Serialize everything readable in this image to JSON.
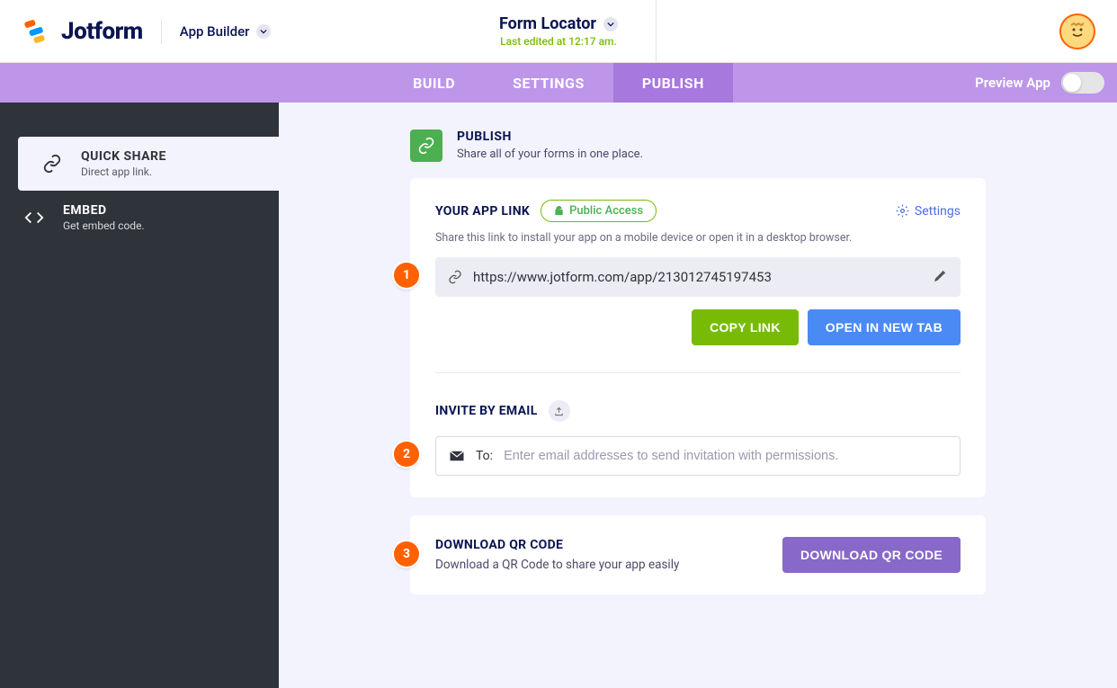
{
  "logo_text": "Jotform",
  "app_builder": "App Builder",
  "form_name": "Form Locator",
  "last_edited": "Last edited at 12:17 am.",
  "nav": {
    "build": "BUILD",
    "settings": "SETTINGS",
    "publish": "PUBLISH",
    "preview": "Preview App"
  },
  "sidebar": {
    "quick_share": {
      "title": "QUICK SHARE",
      "sub": "Direct app link."
    },
    "embed": {
      "title": "EMBED",
      "sub": "Get embed code."
    }
  },
  "publish": {
    "title": "PUBLISH",
    "sub": "Share all of your forms in one place."
  },
  "link_section": {
    "label": "YOUR APP LINK",
    "badge": "Public Access",
    "settings": "Settings",
    "desc": "Share this link to install your app on a mobile device or open it in a desktop browser.",
    "url": "https://www.jotform.com/app/213012745197453",
    "copy": "COPY LINK",
    "open": "OPEN IN NEW TAB"
  },
  "invite": {
    "label": "INVITE BY EMAIL",
    "to": "To:",
    "placeholder": "Enter email addresses to send invitation with permissions."
  },
  "qr": {
    "title": "DOWNLOAD QR CODE",
    "sub": "Download a QR Code to share your app easily",
    "button": "DOWNLOAD QR CODE"
  },
  "steps": {
    "one": "1",
    "two": "2",
    "three": "3"
  }
}
